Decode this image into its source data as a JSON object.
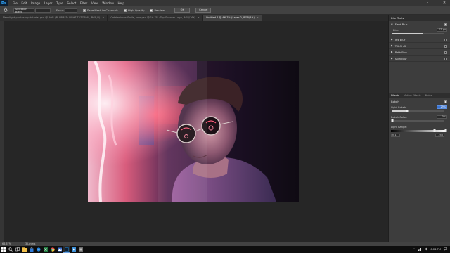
{
  "app": {
    "logo": "Ps",
    "menu": [
      "File",
      "Edit",
      "Image",
      "Layer",
      "Type",
      "Select",
      "Filter",
      "View",
      "Window",
      "Help"
    ],
    "window_controls": [
      "–",
      "□",
      "✕"
    ]
  },
  "options": {
    "selection_mode": "Selection Bleed",
    "focus_label": "Focus",
    "save_mask_label": "Save Mask to Channels",
    "high_quality_label": "High Quality",
    "preview_label": "Preview",
    "ok_label": "OK",
    "cancel_label": "Cancel"
  },
  "tabs": [
    {
      "label": "Neonlight photoshop tutorial.psd @ 50% (BLURRED LIGHT TUTORIAL, RGB/8)",
      "active": false
    },
    {
      "label": "Catstanimas Smile, bws.psd @ 16.7% (Top Shooter Logo, RGB/16*)",
      "active": false
    },
    {
      "label": "Untitled-1 @ 66.7% (Layer 2, RGB/8#)",
      "active": true
    }
  ],
  "blur_tools": {
    "title": "Blur Tools",
    "field_blur": {
      "label": "Field Blur",
      "blur_label": "Blur:",
      "blur_value": "75 px",
      "checked": true
    },
    "items": [
      {
        "label": "Iris Blur",
        "checked": false
      },
      {
        "label": "Tilt-Shift",
        "checked": false
      },
      {
        "label": "Path Blur",
        "checked": false
      },
      {
        "label": "Spin Blur",
        "checked": false
      }
    ]
  },
  "effects": {
    "tabs": [
      "Effects",
      "Motion Effects",
      "Noise"
    ],
    "bokeh_label": "Bokeh",
    "light_bokeh_label": "Light Bokeh:",
    "light_bokeh_value": "29%",
    "light_bokeh_pct": 29,
    "bokeh_color_label": "Bokeh Color:",
    "bokeh_color_value": "0%",
    "bokeh_color_pct": 0,
    "light_range_label": "Light Range:",
    "light_range_min": "201",
    "light_range_max": "255"
  },
  "status": {
    "zoom": "66.67%",
    "layers": "3 Layers"
  },
  "taskbar": {
    "icons": [
      "windows-icon",
      "search-icon",
      "task-view-icon",
      "explorer-icon",
      "store-icon",
      "edge-icon",
      "excel-icon",
      "chrome-icon",
      "photos-icon",
      "photoshop-icon",
      "media-icon",
      "app-icon"
    ],
    "time": "8:24 PM"
  },
  "colors": {
    "accent": "#3a73d0",
    "ps_blue": "#31a8ff"
  }
}
